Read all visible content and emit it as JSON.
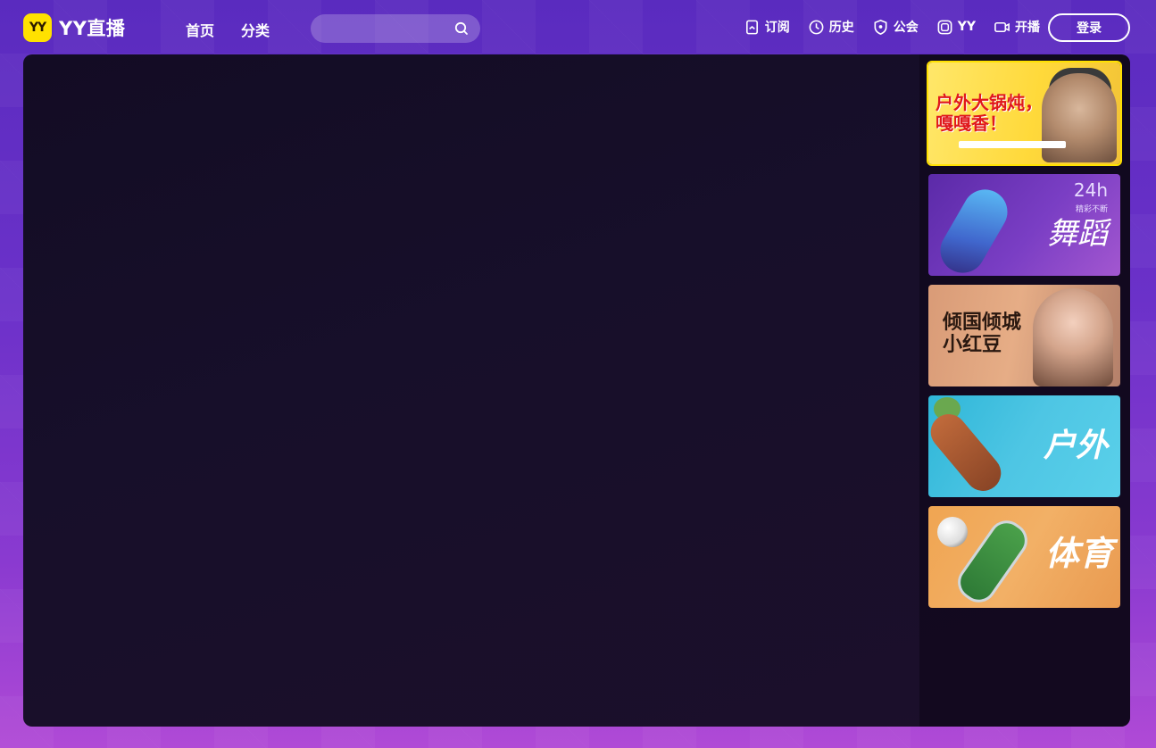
{
  "header": {
    "logo_badge": "YY",
    "logo_text": "YY直播",
    "nav": [
      {
        "label": "首页"
      },
      {
        "label": "分类"
      }
    ],
    "search": {
      "placeholder": "",
      "value": ""
    },
    "tools": [
      {
        "label": "订阅",
        "icon": "bookmark-icon"
      },
      {
        "label": "历史",
        "icon": "clock-icon"
      },
      {
        "label": "公会",
        "icon": "shield-icon"
      },
      {
        "label": "YY",
        "icon": "yy-app-icon"
      },
      {
        "label": "开播",
        "icon": "camera-icon"
      }
    ],
    "login_label": "登录"
  },
  "sidebar": {
    "cards": [
      {
        "caption_line1": "户外大锅炖，",
        "caption_line2": "嘎嘎香！",
        "active": true
      },
      {
        "badge": "24h",
        "badge_sub": "精彩不断",
        "caption": "舞蹈",
        "active": false
      },
      {
        "caption_line1": "倾国倾城",
        "caption_line2": "小红豆",
        "active": false
      },
      {
        "caption": "户外",
        "active": false
      },
      {
        "caption": "体育",
        "active": false
      }
    ]
  },
  "colors": {
    "brand_yellow": "#ffe100",
    "header_purple": "#5a2bbf",
    "stage_dark": "#170f2a"
  }
}
